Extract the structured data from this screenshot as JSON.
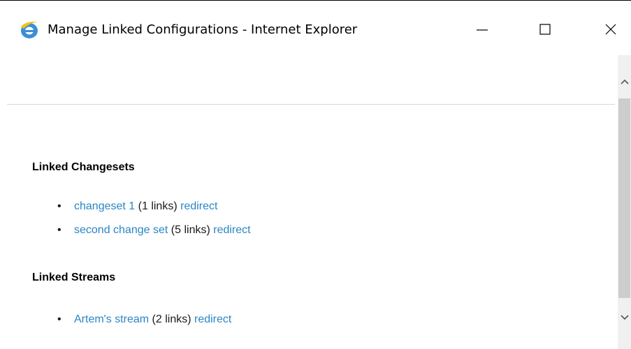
{
  "window": {
    "title": "Manage Linked Configurations - Internet Explorer",
    "app_icon": "internet-explorer-icon",
    "controls": {
      "minimize_icon": "minimize-icon",
      "maximize_icon": "maximize-icon",
      "close_icon": "close-icon"
    }
  },
  "colors": {
    "link": "#2a86c4",
    "text": "#000000",
    "scroll_track": "#f0f0f0",
    "scroll_thumb": "#cdcdcd"
  },
  "sections": [
    {
      "heading": "Linked Changesets",
      "items": [
        {
          "bullet": "•",
          "name": "changeset 1",
          "count": "(1 links)",
          "action": "redirect"
        },
        {
          "bullet": "•",
          "name": "second change set",
          "count": "(5 links)",
          "action": "redirect"
        }
      ]
    },
    {
      "heading": "Linked Streams",
      "items": [
        {
          "bullet": "•",
          "name": "Artem's stream",
          "count": "(2 links)",
          "action": "redirect"
        }
      ]
    }
  ]
}
